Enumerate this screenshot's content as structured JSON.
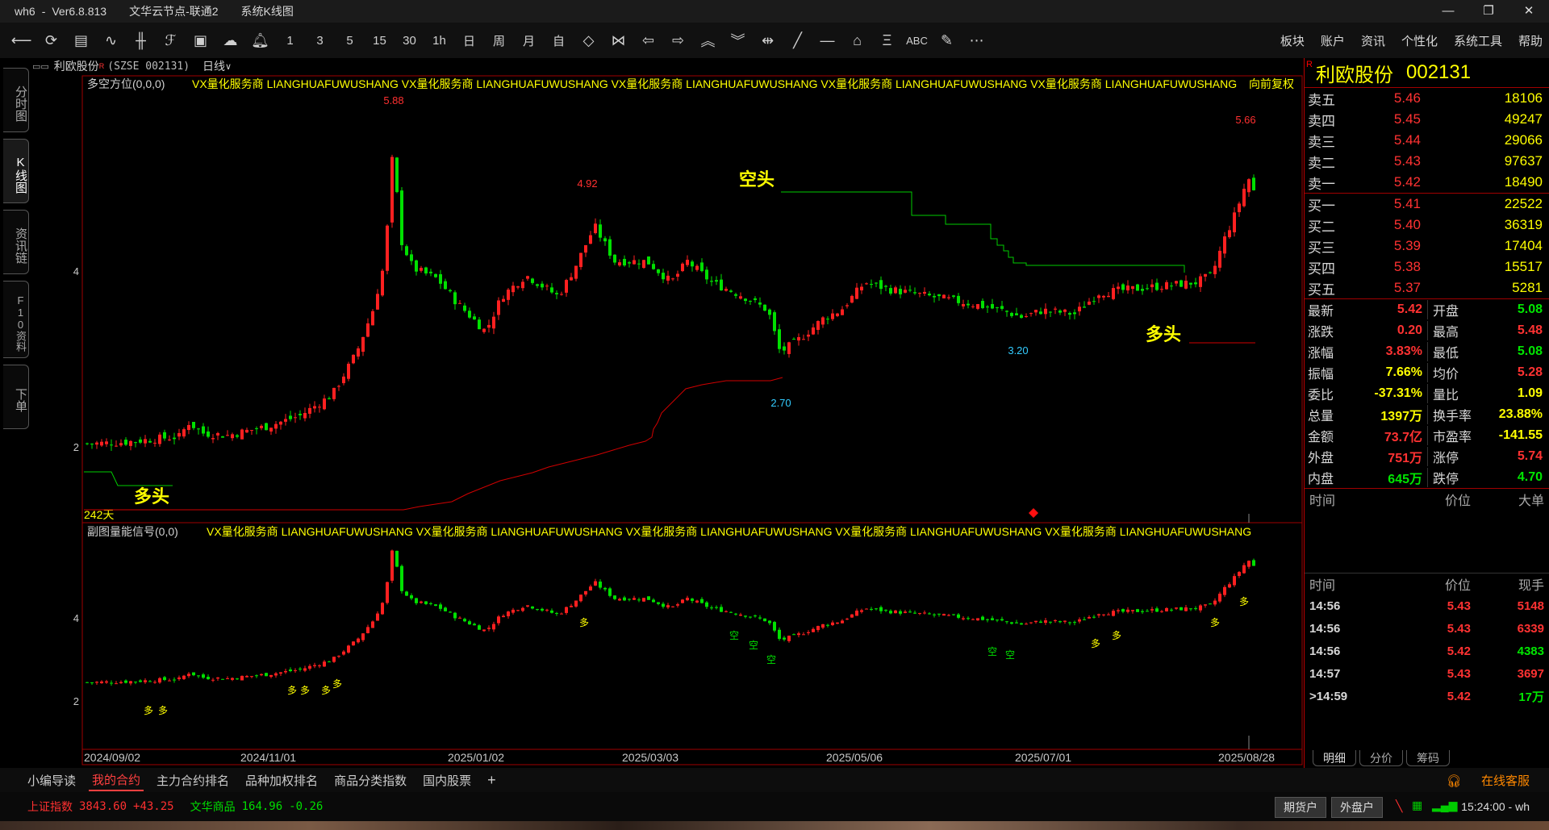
{
  "window": {
    "app": "wh6",
    "version": "Ver6.8.813",
    "node": "文华云节点-联通2",
    "view": "系统K线图"
  },
  "menu": [
    "板块",
    "账户",
    "资讯",
    "个性化",
    "系统工具",
    "帮助"
  ],
  "toolbar": {
    "periods": [
      "1",
      "3",
      "5",
      "15",
      "30",
      "1h",
      "日",
      "周",
      "月",
      "自"
    ],
    "abc": "ABC"
  },
  "left_tabs": [
    "分时图",
    "K线图",
    "资讯链",
    "F10资料",
    "下单"
  ],
  "chart_header": {
    "name": "利欧股份",
    "code": "(SZSE 002131)",
    "period": "日线",
    "main_indicator": "多空方位(0,0,0)",
    "ad_repeat": "VX量化服务商  LIANGHUAFUWUSHANG  VX量化服务商  LIANGHUAFUWUSHANG  VX量化服务商  LIANGHUAFUWUSHANG  VX量化服务商  LIANGHUAFUWUSHANG  VX量化服务商  LIANGHUAFUWUSHANG",
    "adjust": "向前复权",
    "sub_indicator": "副图量能信号(0,0)",
    "sub_ad_repeat": "VX量化服务商  LIANGHUAFUWUSHANG  VX量化服务商  LIANGHUAFUWUSHANG  VX量化服务商  LIANGHUAFUWUSHANG  VX量化服务商  LIANGHUAFUWUSHANG  VX量化服务商  LIANGHUAFUWUSHANG"
  },
  "chart_data": {
    "type": "candlestick",
    "days_label": "242天",
    "main_y_ticks": [
      4.0,
      2.0
    ],
    "sub_y_ticks": [
      4.0,
      2.0
    ],
    "x_labels": [
      "2024/09/02",
      "2024/11/01",
      "2025/01/02",
      "2025/03/03",
      "2025/05/06",
      "2025/07/01",
      "2025/08/28"
    ],
    "annotations": {
      "high1": "5.88",
      "high2": "4.92",
      "low1": "2.70",
      "low2": "3.20",
      "high3": "5.66",
      "short_label": "空头",
      "long_label": "多头"
    },
    "sub_signals": {
      "long": "多",
      "short": "空"
    },
    "up_color": "#ff2020",
    "down_color": "#00e000"
  },
  "quote": {
    "name": "利欧股份",
    "code": "002131",
    "r_mark": "R",
    "asks": [
      {
        "label": "卖五",
        "price": "5.46",
        "vol": "18106"
      },
      {
        "label": "卖四",
        "price": "5.45",
        "vol": "49247"
      },
      {
        "label": "卖三",
        "price": "5.44",
        "vol": "29066"
      },
      {
        "label": "卖二",
        "price": "5.43",
        "vol": "97637"
      },
      {
        "label": "卖一",
        "price": "5.42",
        "vol": "18490"
      }
    ],
    "bids": [
      {
        "label": "买一",
        "price": "5.41",
        "vol": "22522"
      },
      {
        "label": "买二",
        "price": "5.40",
        "vol": "36319"
      },
      {
        "label": "买三",
        "price": "5.39",
        "vol": "17404"
      },
      {
        "label": "买四",
        "price": "5.38",
        "vol": "15517"
      },
      {
        "label": "买五",
        "price": "5.37",
        "vol": "5281"
      }
    ],
    "stats": [
      {
        "l1": "最新",
        "v1": "5.42",
        "c1": "red",
        "l2": "开盘",
        "v2": "5.08",
        "c2": "green"
      },
      {
        "l1": "涨跌",
        "v1": "0.20",
        "c1": "red",
        "l2": "最高",
        "v2": "5.48",
        "c2": "red"
      },
      {
        "l1": "涨幅",
        "v1": "3.83%",
        "c1": "red",
        "l2": "最低",
        "v2": "5.08",
        "c2": "green"
      },
      {
        "l1": "振幅",
        "v1": "7.66%",
        "c1": "yellow",
        "l2": "均价",
        "v2": "5.28",
        "c2": "red"
      },
      {
        "l1": "委比",
        "v1": "-37.31%",
        "c1": "yellow",
        "l2": "量比",
        "v2": "1.09",
        "c2": "yellow"
      },
      {
        "l1": "总量",
        "v1": "1397万",
        "c1": "yellow",
        "l2": "换手率",
        "v2": "23.88%",
        "c2": "yellow"
      },
      {
        "l1": "金额",
        "v1": "73.7亿",
        "c1": "red",
        "l2": "市盈率",
        "v2": "-141.55",
        "c2": "yellow"
      },
      {
        "l1": "外盘",
        "v1": "751万",
        "c1": "red",
        "l2": "涨停",
        "v2": "5.74",
        "c2": "red"
      },
      {
        "l1": "内盘",
        "v1": "645万",
        "c1": "green",
        "l2": "跌停",
        "v2": "4.70",
        "c2": "green"
      }
    ],
    "big_hdr": [
      "时间",
      "价位",
      "大单"
    ],
    "tick_hdr": [
      "时间",
      "价位",
      "现手"
    ],
    "ticks": [
      {
        "t": "14:56",
        "p": "5.43",
        "v": "5148",
        "c": "red"
      },
      {
        "t": "14:56",
        "p": "5.43",
        "v": "6339",
        "c": "red"
      },
      {
        "t": "14:56",
        "p": "5.42",
        "v": "4383",
        "c": "green"
      },
      {
        "t": "14:57",
        "p": "5.43",
        "v": "3697",
        "c": "red"
      },
      {
        "t": ">14:59",
        "p": "5.42",
        "v": "17万",
        "c": "green"
      }
    ],
    "bottom_tabs": [
      "明细",
      "分价",
      "筹码"
    ]
  },
  "bottom_tabs": [
    "小编导读",
    "我的合约",
    "主力合约排名",
    "品种加权排名",
    "商品分类指数",
    "国内股票"
  ],
  "status": {
    "idx1_name": "上证指数",
    "idx1_val": "3843.60",
    "idx1_chg": "+43.25",
    "idx2_name": "文华商品",
    "idx2_val": "164.96",
    "idx2_chg": "-0.26",
    "btn1": "期货户",
    "btn2": "外盘户",
    "service": "在线客服",
    "time": "15:24:00 - wh"
  }
}
